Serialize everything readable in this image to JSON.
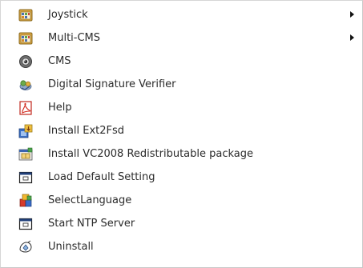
{
  "menu": {
    "items": [
      {
        "label": "Joystick",
        "icon": "program-group-icon",
        "has_submenu": true
      },
      {
        "label": "Multi-CMS",
        "icon": "program-group-icon",
        "has_submenu": true
      },
      {
        "label": "CMS",
        "icon": "webcam-icon",
        "has_submenu": false
      },
      {
        "label": "Digital Signature Verifier",
        "icon": "signature-verifier-icon",
        "has_submenu": false
      },
      {
        "label": "Help",
        "icon": "pdf-document-icon",
        "has_submenu": false
      },
      {
        "label": "Install Ext2Fsd",
        "icon": "installer-icon",
        "has_submenu": false
      },
      {
        "label": "Install VC2008 Redistributable package",
        "icon": "package-installer-icon",
        "has_submenu": false
      },
      {
        "label": "Load Default Setting",
        "icon": "application-window-icon",
        "has_submenu": false
      },
      {
        "label": "SelectLanguage",
        "icon": "language-blocks-icon",
        "has_submenu": false
      },
      {
        "label": "Start NTP Server",
        "icon": "application-window-icon",
        "has_submenu": false
      },
      {
        "label": "Uninstall",
        "icon": "uninstall-icon",
        "has_submenu": false
      }
    ]
  }
}
